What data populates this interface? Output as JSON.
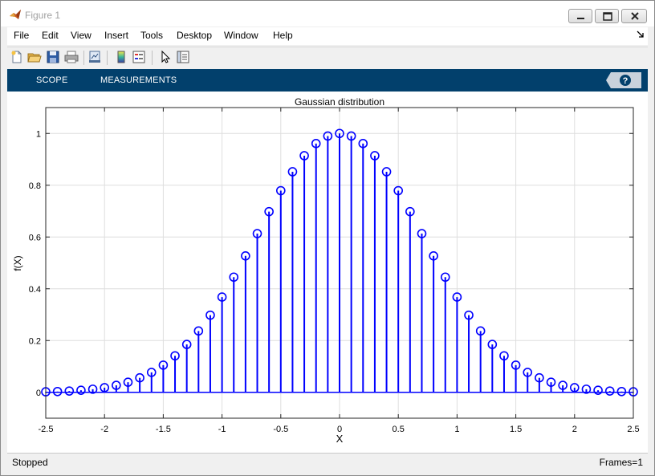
{
  "window": {
    "title": "Figure 1",
    "icons": {
      "app": "matlab-logo-icon",
      "minimize": "minimize-icon",
      "maximize": "maximize-icon",
      "close": "close-icon"
    }
  },
  "menu": {
    "items": [
      "File",
      "Edit",
      "View",
      "Insert",
      "Tools",
      "Desktop",
      "Window",
      "Help"
    ],
    "dock_icon": "dock-arrow-icon"
  },
  "toolbar": {
    "buttons": [
      "new-figure-icon",
      "open-file-icon",
      "save-icon",
      "print-icon",
      "link-plot-icon",
      "colorbar-icon",
      "legend-icon",
      "pointer-icon",
      "property-inspector-icon"
    ]
  },
  "ribbon": {
    "tabs": [
      "SCOPE",
      "MEASUREMENTS"
    ],
    "help_icon": "help-icon",
    "background": "#02406c"
  },
  "chart_data": {
    "type": "stem",
    "title": "Gaussian distribution",
    "xlabel": "X",
    "ylabel": "f(X)",
    "xlim": [
      -2.5,
      2.5
    ],
    "ylim": [
      -0.1,
      1.1
    ],
    "xticks": [
      "-2.5",
      "-2",
      "-1.5",
      "-1",
      "-0.5",
      "0",
      "0.5",
      "1",
      "1.5",
      "2",
      "2.5"
    ],
    "yticks": [
      "0",
      "0.2",
      "0.4",
      "0.6",
      "0.8",
      "1"
    ],
    "grid": true,
    "marker": "circle",
    "color": "#0000ff",
    "series": [
      {
        "x": [
          -2.5,
          -2.4,
          -2.3,
          -2.2,
          -2.1,
          -2.0,
          -1.9,
          -1.8,
          -1.7,
          -1.6,
          -1.5,
          -1.4,
          -1.3,
          -1.2,
          -1.1,
          -1.0,
          -0.9,
          -0.8,
          -0.7,
          -0.6,
          -0.5,
          -0.4,
          -0.3,
          -0.2,
          -0.1,
          0.0,
          0.1,
          0.2,
          0.3,
          0.4,
          0.5,
          0.6,
          0.7,
          0.8,
          0.9,
          1.0,
          1.1,
          1.2,
          1.3,
          1.4,
          1.5,
          1.6,
          1.7,
          1.8,
          1.9,
          2.0,
          2.1,
          2.2,
          2.3,
          2.4,
          2.5
        ],
        "y": [
          0.002,
          0.003,
          0.005,
          0.008,
          0.012,
          0.018,
          0.027,
          0.039,
          0.056,
          0.077,
          0.105,
          0.141,
          0.185,
          0.237,
          0.298,
          0.368,
          0.445,
          0.527,
          0.613,
          0.698,
          0.779,
          0.852,
          0.914,
          0.961,
          0.99,
          1.0,
          0.99,
          0.961,
          0.914,
          0.852,
          0.779,
          0.698,
          0.613,
          0.527,
          0.445,
          0.368,
          0.298,
          0.237,
          0.185,
          0.141,
          0.105,
          0.077,
          0.056,
          0.039,
          0.027,
          0.018,
          0.012,
          0.008,
          0.005,
          0.003,
          0.002
        ]
      }
    ]
  },
  "status": {
    "left": "Stopped",
    "right": "Frames=1"
  }
}
